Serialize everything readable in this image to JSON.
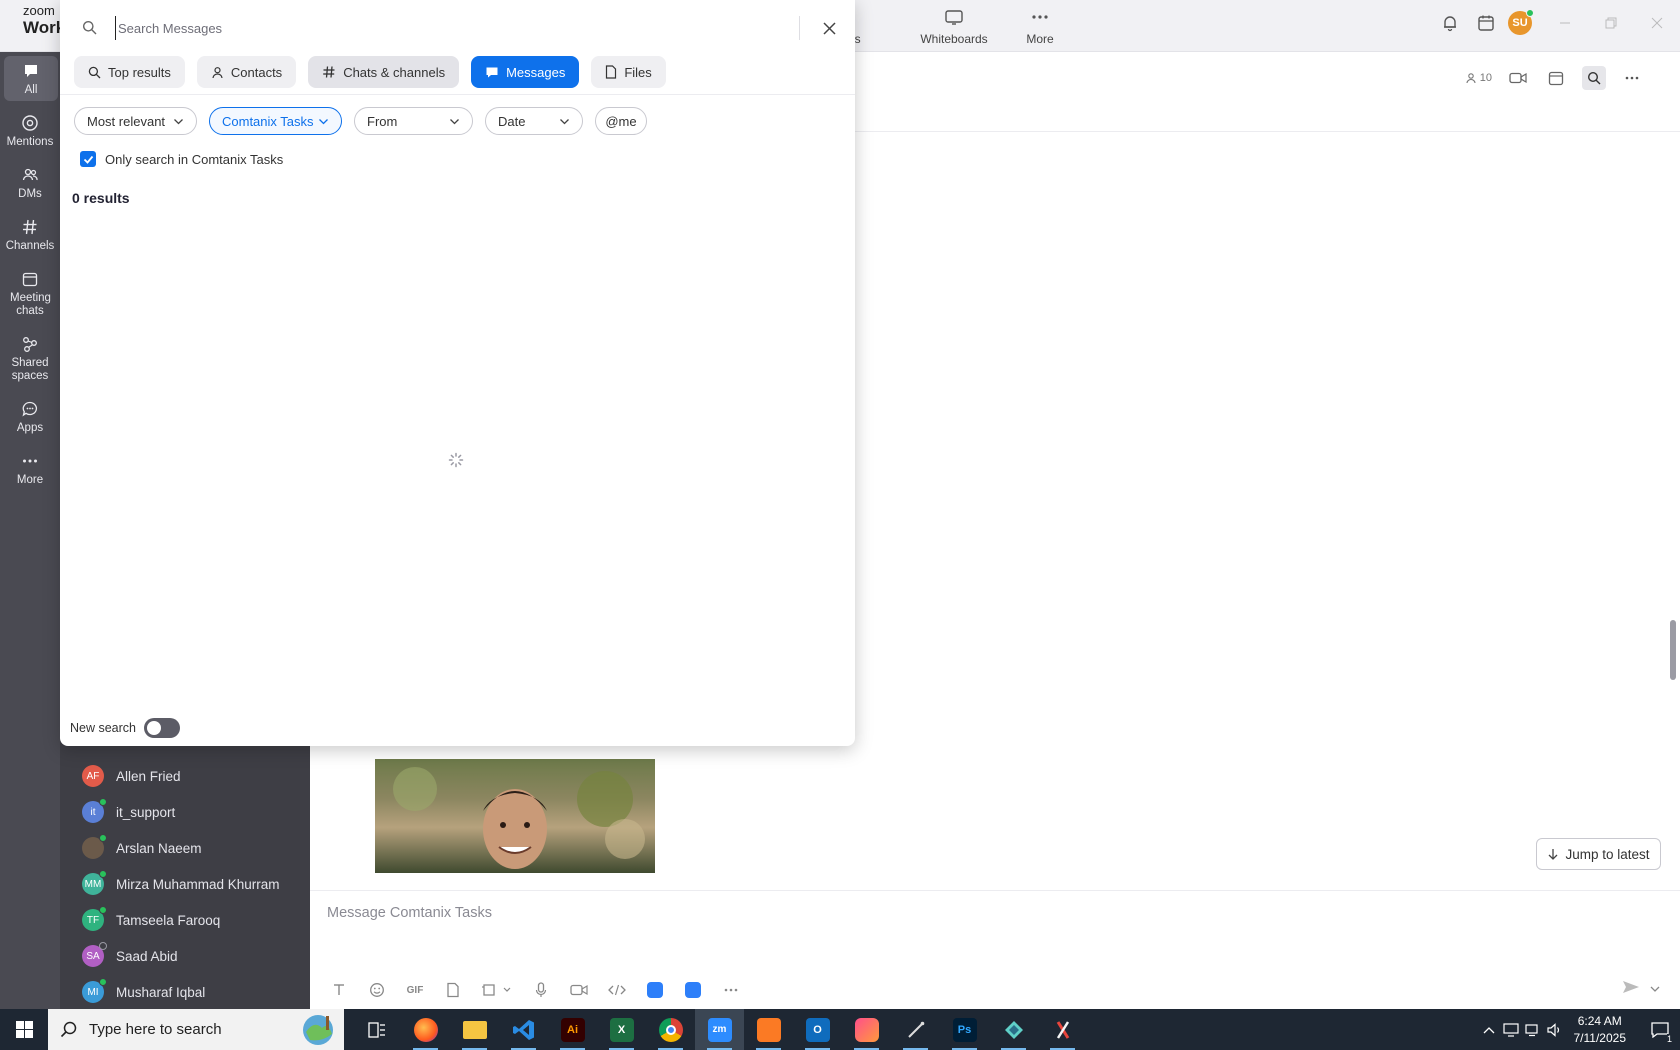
{
  "app": {
    "brand_top": "zoom",
    "brand_bottom": "Work",
    "user_initials": "SU"
  },
  "topnav": [
    {
      "label": "Docs",
      "icon": "document-icon"
    },
    {
      "label": "Whiteboards",
      "icon": "whiteboard-icon"
    },
    {
      "label": "More",
      "icon": "more-horizontal-icon"
    }
  ],
  "rail": [
    {
      "label": "All",
      "icon": "chat-bubble-icon",
      "active": true
    },
    {
      "label": "Mentions",
      "icon": "at-icon"
    },
    {
      "label": "DMs",
      "icon": "people-icon"
    },
    {
      "label": "Channels",
      "icon": "hash-icon"
    },
    {
      "label": "Meeting chats",
      "icon": "calendar-icon"
    },
    {
      "label": "Shared spaces",
      "icon": "shared-spaces-icon"
    },
    {
      "label": "Apps",
      "icon": "apps-bubble-icon"
    },
    {
      "label": "More",
      "icon": "more-horizontal-icon"
    }
  ],
  "chats": [
    {
      "initials": "AF",
      "name": "Allen Fried",
      "color": "#e25b4a",
      "status": "none"
    },
    {
      "initials": "it",
      "name": "it_support",
      "color": "#5a7fd6",
      "status": "online"
    },
    {
      "initials": "",
      "name": "Arslan Naeem",
      "color": "#6b5a4a",
      "status": "online"
    },
    {
      "initials": "MM",
      "name": "Mirza Muhammad Khurram",
      "color": "#3fb39a",
      "status": "online"
    },
    {
      "initials": "TF",
      "name": "Tamseela Farooq",
      "color": "#2fb37f",
      "status": "online"
    },
    {
      "initials": "SA",
      "name": "Saad Abid",
      "color": "#b15fc4",
      "status": "away"
    },
    {
      "initials": "MI",
      "name": "Musharaf Iqbal",
      "color": "#3a9bd8",
      "status": "online"
    }
  ],
  "conversation": {
    "member_count": "10",
    "jump_label": "Jump to latest",
    "composer_placeholder": "Message Comtanix Tasks",
    "gif_label": "GIF"
  },
  "search": {
    "placeholder": "Search Messages",
    "tabs": [
      {
        "label": "Top results",
        "icon": "search-icon"
      },
      {
        "label": "Contacts",
        "icon": "person-icon"
      },
      {
        "label": "Chats & channels",
        "icon": "hash-icon"
      },
      {
        "label": "Messages",
        "icon": "message-icon",
        "active": true
      },
      {
        "label": "Files",
        "icon": "file-icon"
      }
    ],
    "filters": {
      "sort": "Most relevant",
      "channel": "Comtanix Tasks",
      "from": "From",
      "date": "Date",
      "mention": "@me"
    },
    "only_search_label": "Only search in Comtanix Tasks",
    "only_search_checked": true,
    "results_label": "0 results",
    "new_search_label": "New search",
    "new_search_on": false
  },
  "taskbar": {
    "search_placeholder": "Type here to search",
    "time": "6:24 AM",
    "date": "7/11/2025",
    "notification_count": "1",
    "apps": [
      {
        "name": "task-view-icon",
        "label": ""
      },
      {
        "name": "firefox-icon",
        "label": ""
      },
      {
        "name": "file-explorer-icon",
        "label": ""
      },
      {
        "name": "vscode-icon",
        "label": ""
      },
      {
        "name": "illustrator-icon",
        "label": "Ai"
      },
      {
        "name": "excel-icon",
        "label": "X"
      },
      {
        "name": "chrome-icon",
        "label": ""
      },
      {
        "name": "zoom-icon",
        "label": "zm"
      },
      {
        "name": "xampp-icon",
        "label": ""
      },
      {
        "name": "outlook-icon",
        "label": "O"
      },
      {
        "name": "screenshot-tool-icon",
        "label": ""
      },
      {
        "name": "pen-tool-icon",
        "label": ""
      },
      {
        "name": "photoshop-icon",
        "label": "Ps"
      },
      {
        "name": "app-diamond-icon",
        "label": ""
      },
      {
        "name": "app-red-icon",
        "label": ""
      }
    ]
  }
}
